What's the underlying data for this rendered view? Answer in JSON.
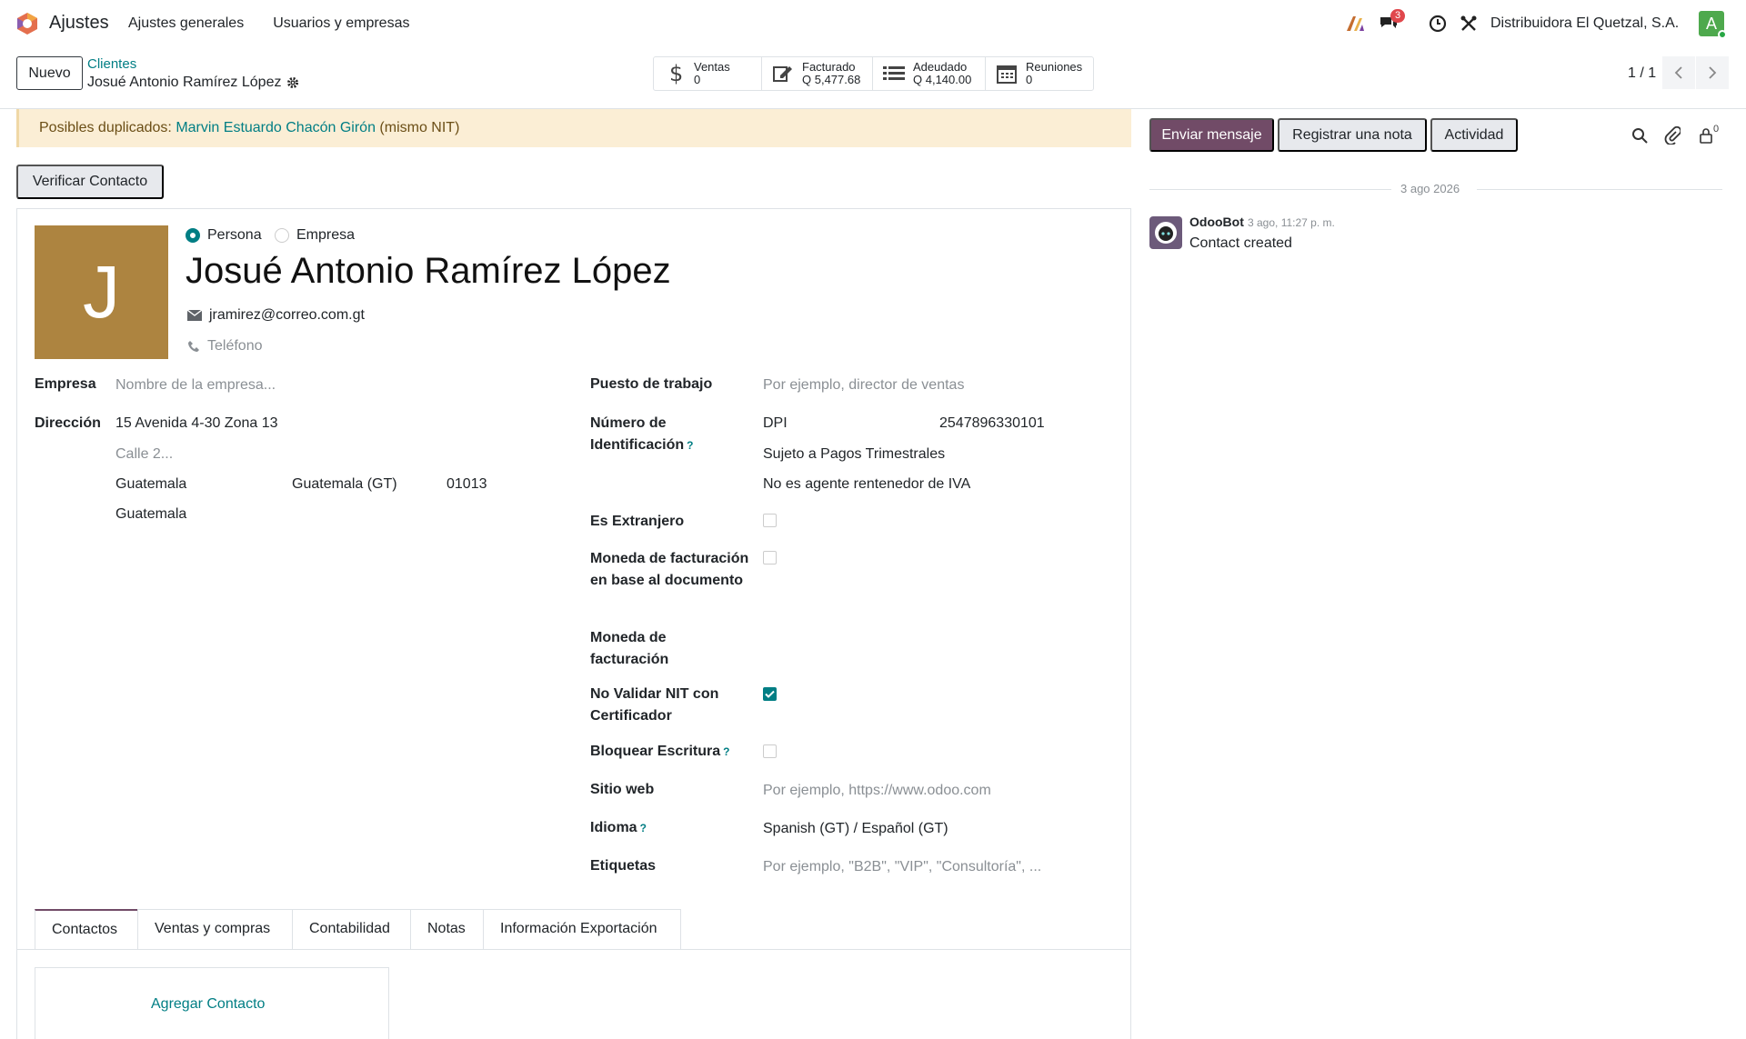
{
  "navbar": {
    "app_name": "Ajustes",
    "menu": [
      "Ajustes generales",
      "Usuarios y empresas"
    ],
    "messages_badge": "3",
    "company": "Distribuidora El Quetzal, S.A.",
    "user_initial": "A"
  },
  "control": {
    "new_label": "Nuevo",
    "breadcrumb_parent": "Clientes",
    "breadcrumb_current": "Josué Antonio Ramírez López",
    "pager": "1 / 1",
    "smart_buttons": [
      {
        "label": "Ventas",
        "value": "0",
        "icon": "dollar-icon"
      },
      {
        "label": "Facturado",
        "value": "Q 5,477.68",
        "icon": "edit-icon"
      },
      {
        "label": "Adeudado",
        "value": "Q 4,140.00",
        "icon": "list-icon"
      },
      {
        "label": "Reuniones",
        "value": "0",
        "icon": "calendar-icon"
      }
    ]
  },
  "form": {
    "warning_prefix": "Posibles duplicados: ",
    "warning_link": "Marvin Estuardo Chacón Girón",
    "warning_suffix": " (mismo NIT)",
    "verify_label": "Verificar Contacto",
    "avatar_letter": "J",
    "type_person": "Persona",
    "type_company": "Empresa",
    "name": "Josué Antonio Ramírez López",
    "email": "jramirez@correo.com.gt",
    "phone_placeholder": "Teléfono",
    "company_label": "Empresa",
    "company_placeholder": "Nombre de la empresa...",
    "address_label": "Dirección",
    "street": "15 Avenida 4-30 Zona 13",
    "street2_placeholder": "Calle 2...",
    "city": "Guatemala",
    "state": "Guatemala (GT)",
    "zip": "01013",
    "country": "Guatemala",
    "job_label": "Puesto de trabajo",
    "job_placeholder": "Por ejemplo, director de ventas",
    "id_label": "Número de Identificación",
    "id_type": "DPI",
    "id_number": "2547896330101",
    "tax_regime": "Sujeto a Pagos Trimestrales",
    "iva_agent": "No es agente rentenedor de IVA",
    "foreign_label": "Es Extranjero",
    "doc_currency_label": "Moneda de facturación en base al documento",
    "currency_label": "Moneda de facturación",
    "no_validate_label": "No Validar NIT con Certificador",
    "lock_label": "Bloquear Escritura",
    "website_label": "Sitio web",
    "website_placeholder": "Por ejemplo, https://www.odoo.com",
    "lang_label": "Idioma",
    "lang_value": "Spanish (GT) / Español (GT)",
    "tags_label": "Etiquetas",
    "tags_placeholder": "Por ejemplo, \"B2B\", \"VIP\", \"Consultoría\", ...",
    "help_mark": "?",
    "tabs": [
      "Contactos",
      "Ventas y compras",
      "Contabilidad",
      "Notas",
      "Información Exportación"
    ],
    "add_contact": "Agregar Contacto"
  },
  "chatter": {
    "send_message": "Enviar mensaje",
    "log_note": "Registrar una nota",
    "activity": "Actividad",
    "followers_count": "0",
    "date": "3 ago 2026",
    "author": "OdooBot",
    "time": "3 ago, 11:27 p. m.",
    "message": "Contact created"
  },
  "colors": {
    "primary": "#714b67",
    "link": "#017e84",
    "avatar": "#ad8440",
    "warning_bg": "#fbeed5"
  }
}
